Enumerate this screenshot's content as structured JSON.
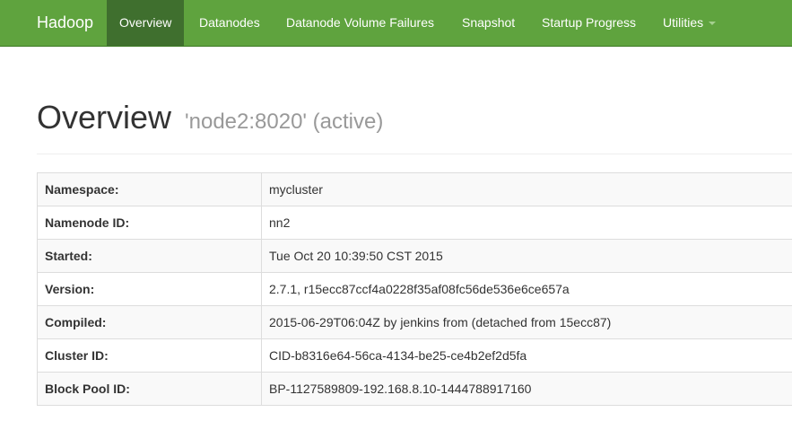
{
  "navbar": {
    "brand": "Hadoop",
    "items": [
      {
        "label": "Overview",
        "active": true
      },
      {
        "label": "Datanodes"
      },
      {
        "label": "Datanode Volume Failures"
      },
      {
        "label": "Snapshot"
      },
      {
        "label": "Startup Progress"
      },
      {
        "label": "Utilities",
        "has_dropdown": true
      }
    ]
  },
  "header": {
    "title": "Overview",
    "subtitle": "'node2:8020' (active)"
  },
  "info_table": {
    "rows": [
      {
        "key": "Namespace:",
        "value": "mycluster"
      },
      {
        "key": "Namenode ID:",
        "value": "nn2"
      },
      {
        "key": "Started:",
        "value": "Tue Oct 20 10:39:50 CST 2015"
      },
      {
        "key": "Version:",
        "value": "2.7.1, r15ecc87ccf4a0228f35af08fc56de536e6ce657a"
      },
      {
        "key": "Compiled:",
        "value": "2015-06-29T06:04Z by jenkins from (detached from 15ecc87)"
      },
      {
        "key": "Cluster ID:",
        "value": "CID-b8316e64-56ca-4134-be25-ce4b2ef2d5fa"
      },
      {
        "key": "Block Pool ID:",
        "value": "BP-1127589809-192.168.8.10-1444788917160"
      }
    ]
  },
  "colors": {
    "navbar_bg": "#5fa33e",
    "navbar_active_bg": "#3f6f2e"
  }
}
